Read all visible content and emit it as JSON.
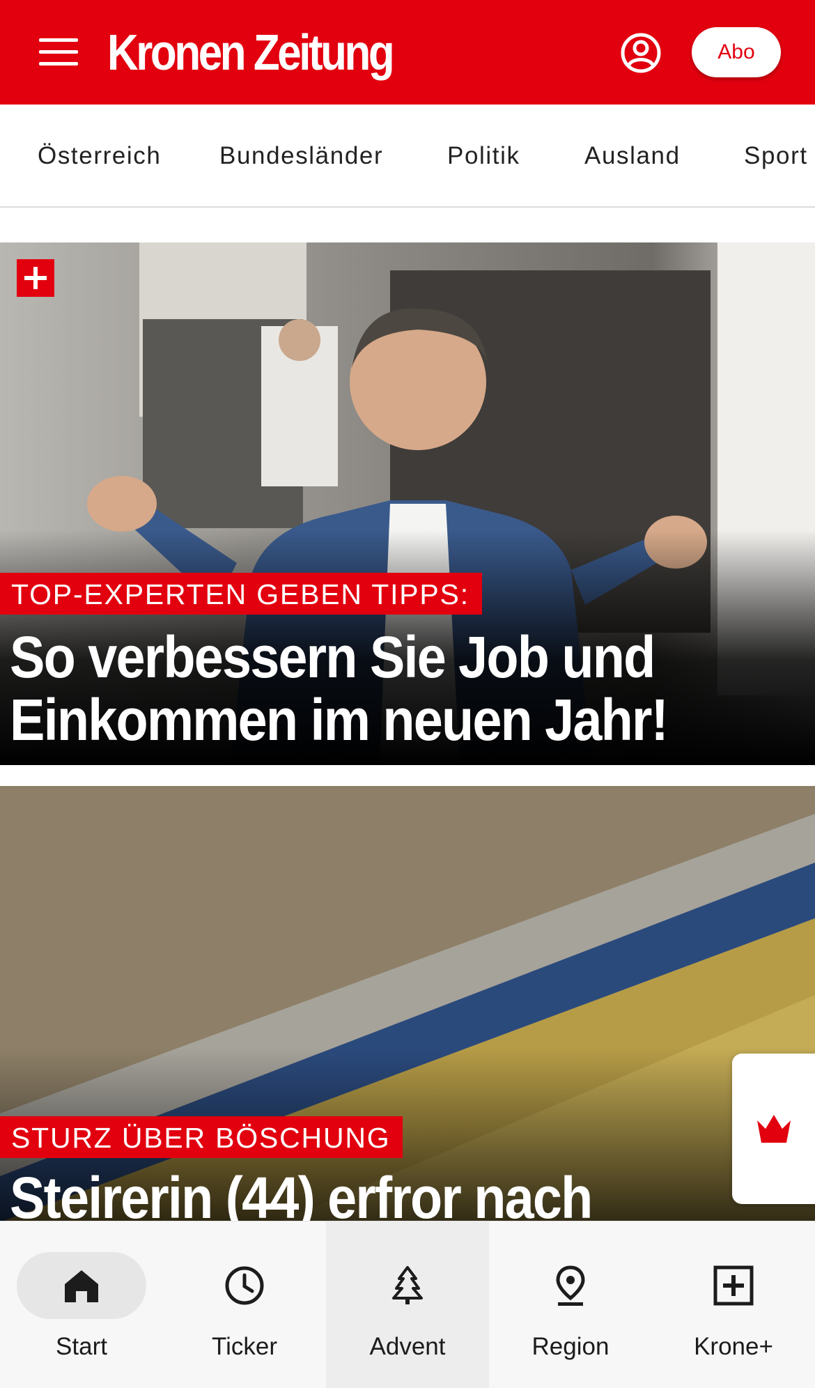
{
  "header": {
    "logo_text": "Kronen Zeitung",
    "account_icon": "account-circle-icon",
    "menu_icon": "hamburger-menu-icon",
    "abo_label": "Abo",
    "brand_color": "#e2000f"
  },
  "categories": [
    "Österreich",
    "Bundesländer",
    "Politik",
    "Ausland",
    "Sport"
  ],
  "articles": [
    {
      "premium_icon": "plus-badge-icon",
      "kicker": "TOP-EXPERTEN GEBEN TIPPS:",
      "headline_line1": "So verbessern Sie Job und",
      "headline_line2": "Einkommen im neuen Jahr!"
    },
    {
      "kicker": "STURZ ÜBER BÖSCHUNG",
      "headline_line1": "Steirerin (44) erfror nach"
    }
  ],
  "floating_widget": {
    "icon": "krone-crown-icon"
  },
  "bottom_nav": [
    {
      "label": "Start",
      "icon": "home-icon",
      "active": true
    },
    {
      "label": "Ticker",
      "icon": "clock-icon",
      "active": false
    },
    {
      "label": "Advent",
      "icon": "tree-icon",
      "active": false
    },
    {
      "label": "Region",
      "icon": "location-pin-icon",
      "active": false
    },
    {
      "label": "Krone+",
      "icon": "plus-box-icon",
      "active": false
    }
  ]
}
